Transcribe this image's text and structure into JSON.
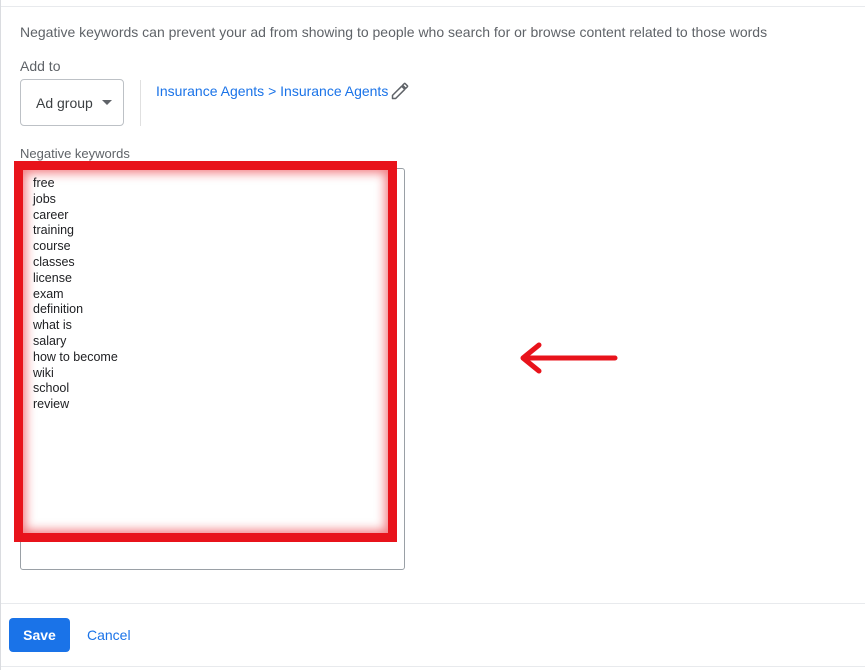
{
  "description": "Negative keywords can prevent your ad from showing to people who search for or browse content related to those words",
  "add_to": {
    "label": "Add to",
    "selected": "Ad group"
  },
  "breadcrumb": "Insurance Agents > Insurance Agents",
  "negative_keywords": {
    "label": "Negative keywords",
    "items": [
      "free",
      "jobs",
      "career",
      "training",
      "course",
      "classes",
      "license",
      "exam",
      "definition",
      "what is",
      "salary",
      "how to become",
      "wiki",
      "school",
      "review"
    ]
  },
  "colors": {
    "highlight": "#e8131b",
    "primary": "#1a73e8"
  },
  "actions": {
    "save": "Save",
    "cancel": "Cancel"
  }
}
